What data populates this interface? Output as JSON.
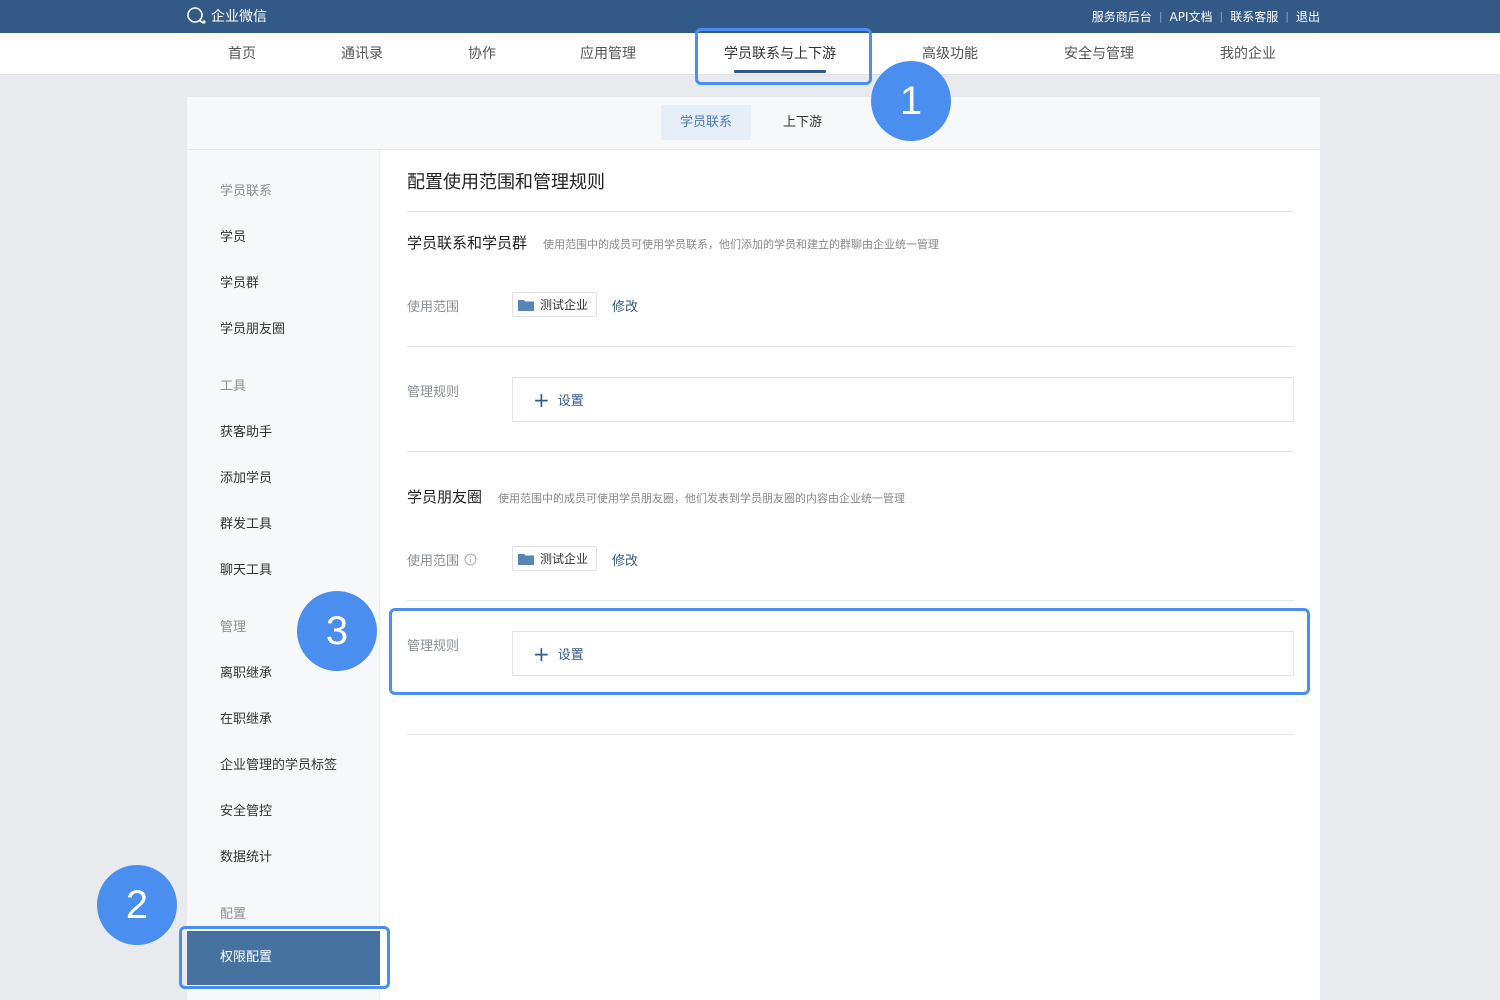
{
  "app": {
    "logo_text": "企业微信"
  },
  "top_links": [
    "服务商后台",
    "API文档",
    "联系客服",
    "退出"
  ],
  "nav": {
    "items": [
      "首页",
      "通讯录",
      "协作",
      "应用管理",
      "学员联系与上下游",
      "高级功能",
      "安全与管理",
      "我的企业"
    ],
    "active_index": 4
  },
  "subtabs": {
    "items": [
      "学员联系",
      "上下游"
    ],
    "active_index": 0
  },
  "sidebar": {
    "groups": [
      {
        "heading": "学员联系",
        "items": [
          "学员",
          "学员群",
          "学员朋友圈"
        ]
      },
      {
        "heading": "工具",
        "items": [
          "获客助手",
          "添加学员",
          "群发工具",
          "聊天工具"
        ]
      },
      {
        "heading": "管理",
        "items": [
          "离职继承",
          "在职继承",
          "企业管理的学员标签",
          "安全管控",
          "数据统计"
        ]
      },
      {
        "heading": "配置",
        "items": [
          "权限配置"
        ]
      }
    ],
    "active_item": "权限配置"
  },
  "content": {
    "title": "配置使用范围和管理规则",
    "sections": [
      {
        "title": "学员联系和学员群",
        "description": "使用范围中的成员可使用学员联系，他们添加的学员和建立的群聊由企业统一管理",
        "scope_label": "使用范围",
        "scope_value": "测试企业",
        "modify_label": "修改",
        "rule_label": "管理规则",
        "rule_button": "设置"
      },
      {
        "title": "学员朋友圈",
        "description": "使用范围中的成员可使用学员朋友圈，他们发表到学员朋友圈的内容由企业统一管理",
        "scope_label": "使用范围",
        "scope_value": "测试企业",
        "modify_label": "修改",
        "rule_label": "管理规则",
        "rule_button": "设置"
      }
    ]
  },
  "annotations": [
    "1",
    "2",
    "3"
  ],
  "colors": {
    "primary": "#335a86",
    "highlight": "#4a8ff0",
    "active_sidebar": "#45729f"
  }
}
